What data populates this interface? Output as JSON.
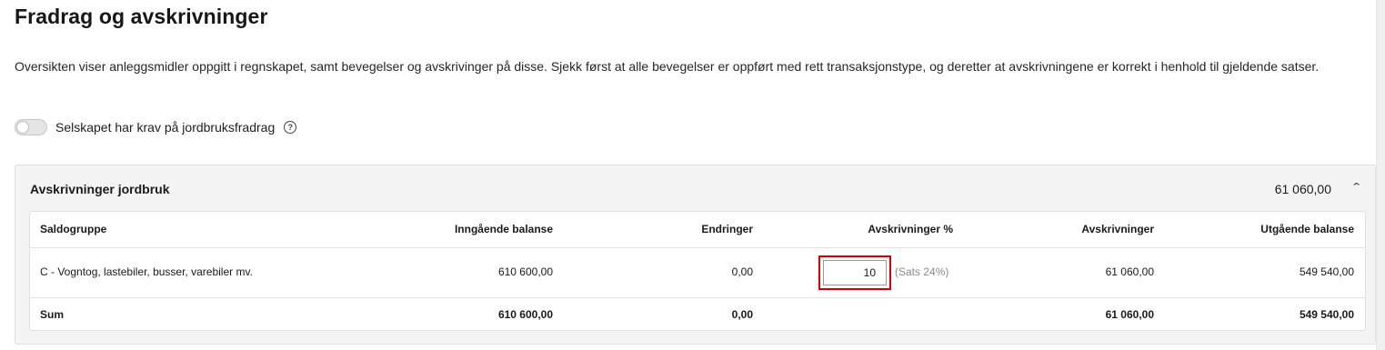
{
  "page": {
    "title": "Fradrag og avskrivninger",
    "intro": "Oversikten viser anleggsmidler oppgitt i regnskapet, samt bevegelser og avskrivinger på disse. Sjekk først at alle bevegelser er oppført med rett transaksjonstype, og deretter at avskrivningene er korrekt i henhold til gjeldende satser."
  },
  "toggle": {
    "label": "Selskapet har krav på jordbruksfradrag",
    "checked": false,
    "help_icon": "question-circle-icon"
  },
  "section": {
    "title": "Avskrivninger jordbruk",
    "total": "61 060,00",
    "collapse_icon": "chevron-up-icon",
    "columns": [
      "Saldogruppe",
      "Inngående balanse",
      "Endringer",
      "Avskrivninger %",
      "Avskrivninger",
      "Utgående balanse"
    ],
    "rows": [
      {
        "saldogruppe": "C - Vogntog, lastebiler, busser, varebiler mv.",
        "inngaende": "610 600,00",
        "endringer": "0,00",
        "pct_value": "10",
        "sats": "(Sats 24%)",
        "avskrivninger": "61 060,00",
        "utgaende": "549 540,00"
      }
    ],
    "sum": {
      "label": "Sum",
      "inngaende": "610 600,00",
      "endringer": "0,00",
      "avskrivninger": "61 060,00",
      "utgaende": "549 540,00"
    }
  },
  "colors": {
    "highlight": "#d40000",
    "card_bg": "#f4f4f4"
  }
}
